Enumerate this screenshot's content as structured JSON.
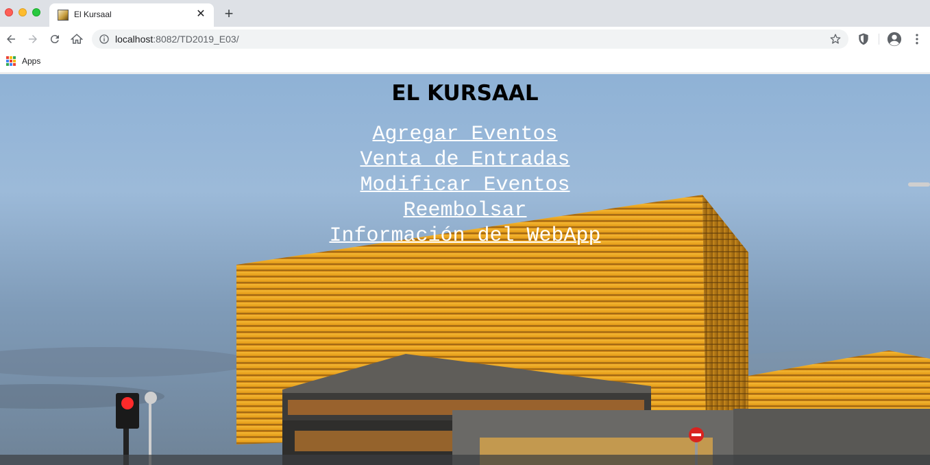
{
  "browser": {
    "tab_title": "El Kursaal",
    "url_host": "localhost",
    "url_path": ":8082/TD2019_E03/",
    "bookmarks": [
      {
        "label": "Apps"
      }
    ]
  },
  "page": {
    "heading": "EL KURSAAL",
    "nav_links": [
      {
        "label": "Agregar Eventos"
      },
      {
        "label": "Venta de Entradas"
      },
      {
        "label": "Modificar Eventos"
      },
      {
        "label": "Reembolsar"
      },
      {
        "label": "Información del WebApp"
      }
    ]
  },
  "icons": [
    "favicon-icon",
    "close-icon",
    "plus-icon",
    "back-icon",
    "forward-icon",
    "reload-icon",
    "home-icon",
    "info-icon",
    "star-icon",
    "shield-icon",
    "profile-icon",
    "more-icon",
    "apps-icon"
  ],
  "colors": {
    "tabstrip_bg": "#dee1e6",
    "omnibox_bg": "#f1f3f4",
    "link_color": "#ffffff",
    "heading_color": "#000000"
  }
}
